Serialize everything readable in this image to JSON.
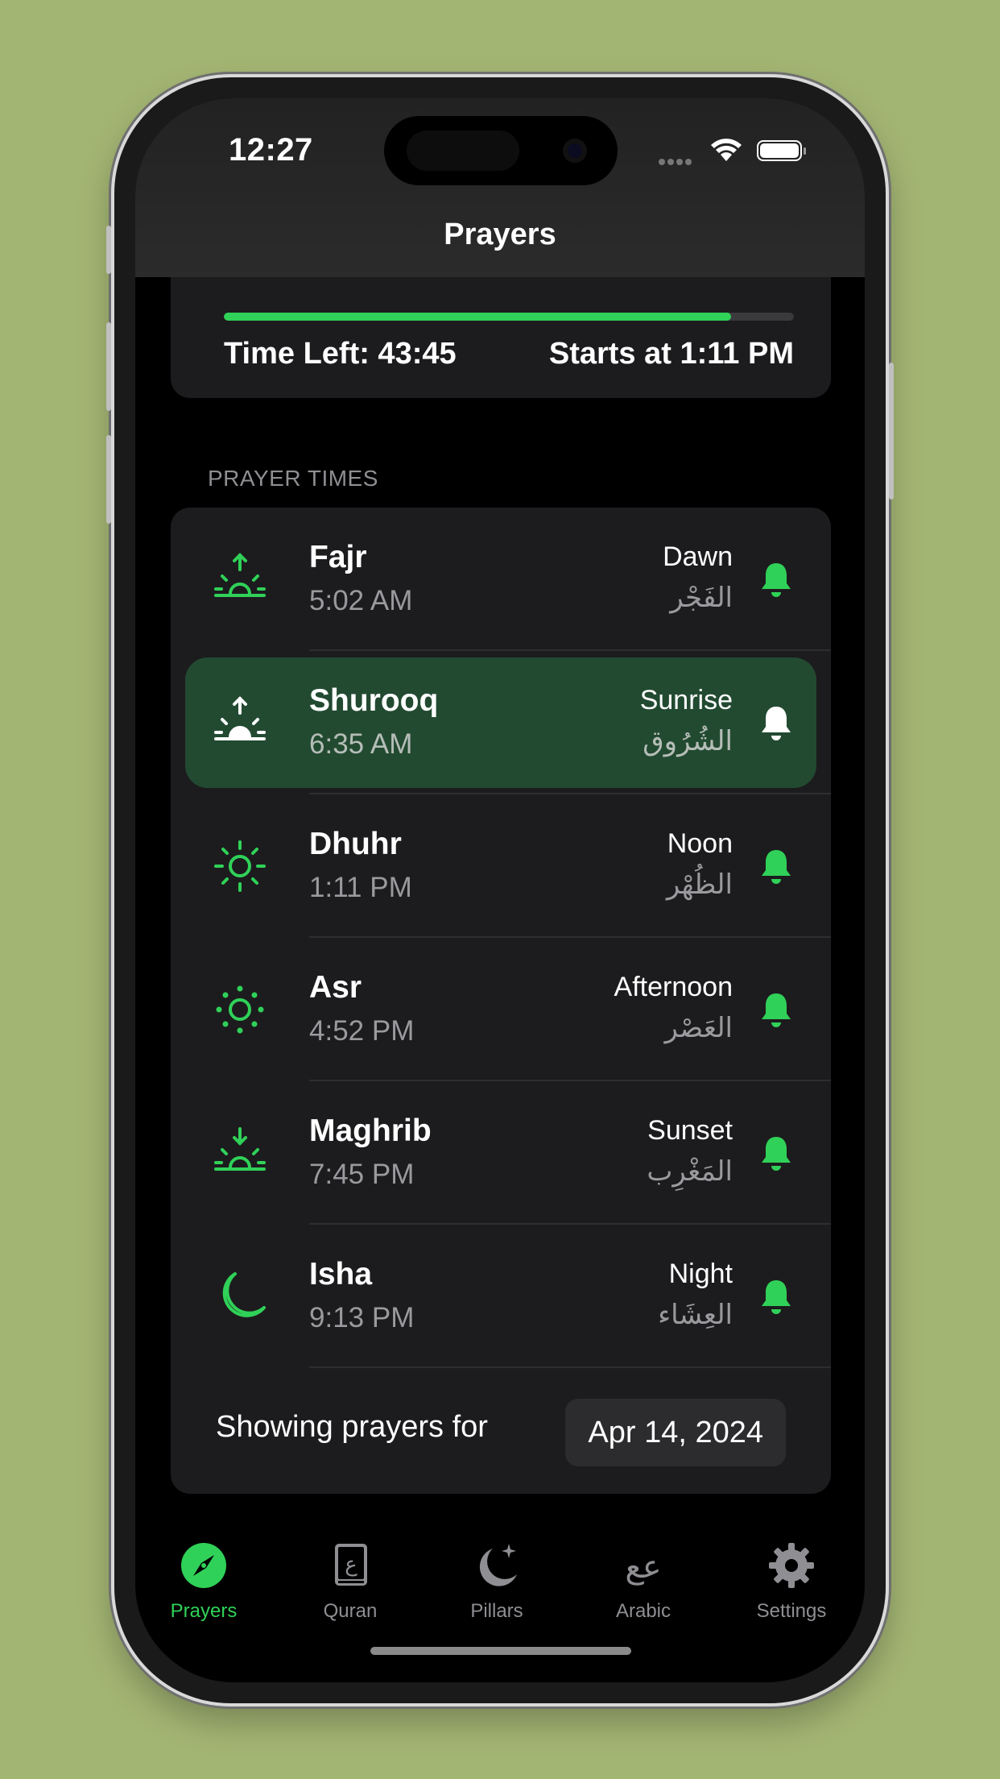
{
  "status_bar": {
    "time": "12:27"
  },
  "nav": {
    "title": "Prayers"
  },
  "countdown": {
    "progress_fraction": 0.89,
    "time_left": "Time Left: 43:45",
    "starts_at": "Starts at 1:11 PM"
  },
  "section": {
    "header": "PRAYER TIMES"
  },
  "prayers": [
    {
      "name": "Fajr",
      "time": "5:02 AM",
      "english": "Dawn",
      "arabic": "الفَجْر",
      "icon": "sunrise-icon",
      "active": false
    },
    {
      "name": "Shurooq",
      "time": "6:35 AM",
      "english": "Sunrise",
      "arabic": "الشُرُوق",
      "icon": "sunrise-icon",
      "active": true
    },
    {
      "name": "Dhuhr",
      "time": "1:11 PM",
      "english": "Noon",
      "arabic": "الظُهْر",
      "icon": "sun-icon",
      "active": false
    },
    {
      "name": "Asr",
      "time": "4:52 PM",
      "english": "Afternoon",
      "arabic": "العَصْر",
      "icon": "sun-dots-icon",
      "active": false
    },
    {
      "name": "Maghrib",
      "time": "7:45 PM",
      "english": "Sunset",
      "arabic": "المَغْرِب",
      "icon": "sunset-icon",
      "active": false
    },
    {
      "name": "Isha",
      "time": "9:13 PM",
      "english": "Night",
      "arabic": "العِشَاء",
      "icon": "moon-icon",
      "active": false
    }
  ],
  "date_picker": {
    "label": "Showing prayers for",
    "value": "Apr 14, 2024"
  },
  "tabs": [
    {
      "label": "Prayers",
      "icon": "compass-icon",
      "active": true
    },
    {
      "label": "Quran",
      "icon": "book-icon",
      "active": false
    },
    {
      "label": "Pillars",
      "icon": "moon-stars-icon",
      "active": false
    },
    {
      "label": "Arabic",
      "icon": "arabic-letters-icon",
      "active": false
    },
    {
      "label": "Settings",
      "icon": "gear-icon",
      "active": false
    }
  ],
  "colors": {
    "accent": "#30d158",
    "background": "#a3b573",
    "card": "#1c1c1e",
    "active_row": "#224a31"
  }
}
